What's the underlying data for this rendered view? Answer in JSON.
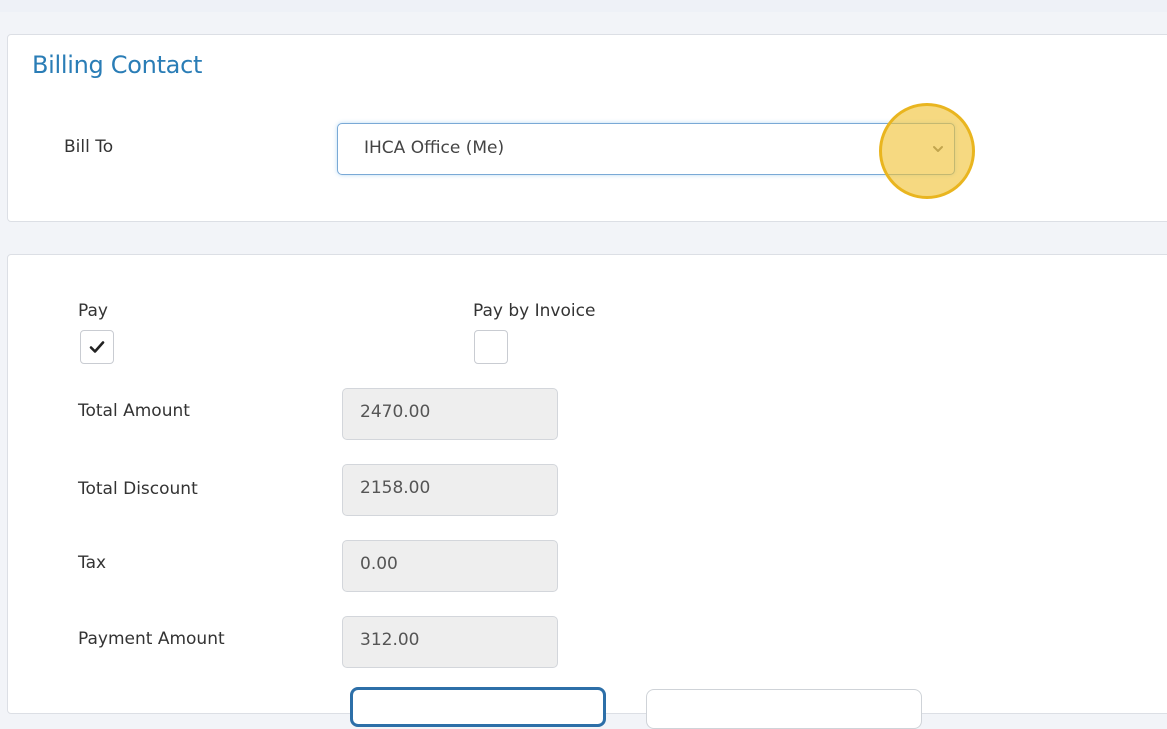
{
  "billing_contact": {
    "title": "Billing Contact",
    "bill_to_label": "Bill To",
    "bill_to_value": "IHCA Office (Me)"
  },
  "payment": {
    "pay_label": "Pay",
    "pay_checked": true,
    "pay_by_invoice_label": "Pay by Invoice",
    "pay_by_invoice_checked": false,
    "fields": {
      "total_amount": {
        "label": "Total Amount",
        "value": "2470.00"
      },
      "total_discount": {
        "label": "Total Discount",
        "value": "2158.00"
      },
      "tax": {
        "label": "Tax",
        "value": "0.00"
      },
      "payment_amount": {
        "label": "Payment Amount",
        "value": "312.00"
      }
    }
  },
  "colors": {
    "title_blue": "#2a7db6",
    "highlight": "#f0c234",
    "primary_border": "#2d6fa8"
  }
}
